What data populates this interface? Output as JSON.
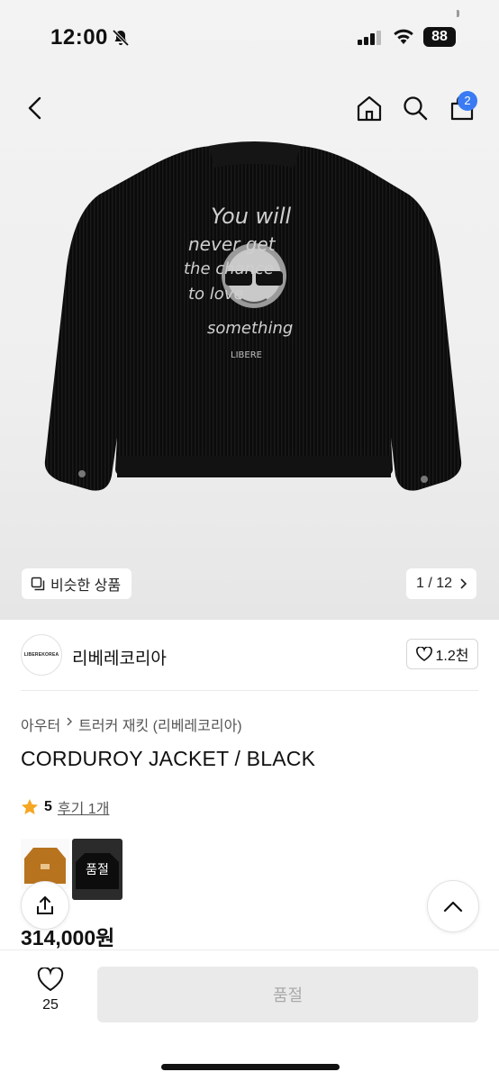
{
  "status_bar": {
    "time": "12:00",
    "battery": "88"
  },
  "nav": {
    "cart_count": "2",
    "icons": [
      "back-icon",
      "home-icon",
      "search-icon",
      "cart-icon"
    ]
  },
  "gallery": {
    "similar_label": "비슷한 상품",
    "pager": "1 / 12",
    "print_text_lines": [
      "You will",
      "never get",
      "the chance",
      "to love",
      "something",
      "LIBERE"
    ]
  },
  "brand": {
    "logo_text": "LIBEREKOREA",
    "name": "리베레코리아",
    "likes": "1.2천"
  },
  "product": {
    "breadcrumb": [
      "아우터",
      "트러커 재킷 (리베레코리아)"
    ],
    "title": "CORDUROY JACKET / BLACK",
    "rating": "5",
    "reviews": "후기 1개",
    "soldout_label": "품절",
    "price": "314,000원"
  },
  "bottom": {
    "wish_count": "25",
    "buy_label": "품절"
  },
  "colors": {
    "accent": "#3a7bf4",
    "star": "#f5a623",
    "disabled_bg": "#eaeaea"
  }
}
